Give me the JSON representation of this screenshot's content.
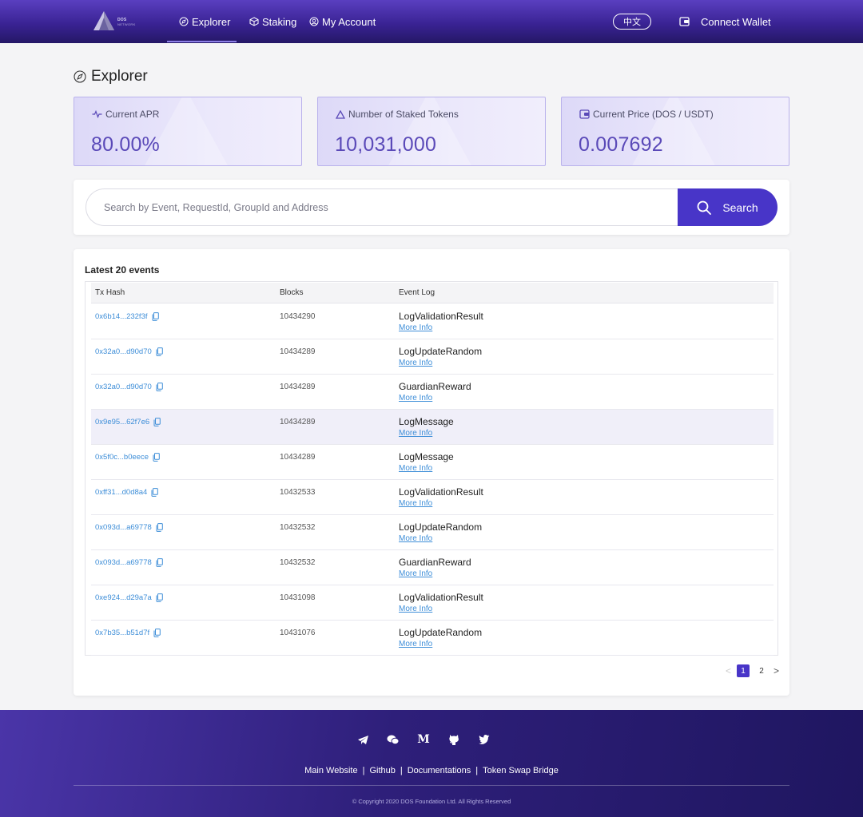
{
  "header": {
    "logo_line1": "DOS",
    "logo_line2": "NETWORK",
    "nav": [
      {
        "label": "Explorer",
        "icon": "compass-icon"
      },
      {
        "label": "Staking",
        "icon": "box-icon"
      },
      {
        "label": "My Account",
        "icon": "user-icon"
      }
    ],
    "lang_label": "中文",
    "wallet_label": "Connect Wallet"
  },
  "page_title": "Explorer",
  "stats": [
    {
      "label": "Current APR",
      "value": "80.00%",
      "icon": "pulse-icon"
    },
    {
      "label": "Number of Staked Tokens",
      "value": "10,031,000",
      "icon": "triangle-icon"
    },
    {
      "label": "Current Price (DOS / USDT)",
      "value": "0.007692",
      "icon": "wallet-icon"
    }
  ],
  "search": {
    "placeholder": "Search by Event, RequestId, GroupId and Address",
    "button_label": "Search"
  },
  "events": {
    "title": "Latest 20 events",
    "columns": [
      "Tx Hash",
      "Blocks",
      "Event Log"
    ],
    "more_label": "More Info",
    "rows": [
      {
        "hash": "0x6b14...232f3f",
        "block": "10434290",
        "event": "LogValidationResult"
      },
      {
        "hash": "0x32a0...d90d70",
        "block": "10434289",
        "event": "LogUpdateRandom"
      },
      {
        "hash": "0x32a0...d90d70",
        "block": "10434289",
        "event": "GuardianReward"
      },
      {
        "hash": "0x9e95...62f7e6",
        "block": "10434289",
        "event": "LogMessage"
      },
      {
        "hash": "0x5f0c...b0eece",
        "block": "10434289",
        "event": "LogMessage"
      },
      {
        "hash": "0xff31...d0d8a4",
        "block": "10432533",
        "event": "LogValidationResult"
      },
      {
        "hash": "0x093d...a69778",
        "block": "10432532",
        "event": "LogUpdateRandom"
      },
      {
        "hash": "0x093d...a69778",
        "block": "10432532",
        "event": "GuardianReward"
      },
      {
        "hash": "0xe924...d29a7a",
        "block": "10431098",
        "event": "LogValidationResult"
      },
      {
        "hash": "0x7b35...b51d7f",
        "block": "10431076",
        "event": "LogUpdateRandom"
      }
    ],
    "pagination": {
      "prev": "<",
      "pages": [
        "1",
        "2"
      ],
      "active": "1",
      "next": ">"
    }
  },
  "footer": {
    "social_icons": [
      "telegram-icon",
      "wechat-icon",
      "medium-icon",
      "github-icon",
      "twitter-icon"
    ],
    "medium_glyph": "M",
    "links": [
      "Main Website",
      "Github",
      "Documentations",
      "Token Swap Bridge"
    ],
    "separator": "|",
    "copyright": "© Copyright 2020 DOS Foundation Ltd. All Rights Reserved"
  },
  "colors": {
    "accent": "#4835c8",
    "link": "#3e8ed8",
    "stat_value": "#5a49b8",
    "header_top": "#5a3fc0",
    "header_bottom": "#241766"
  }
}
